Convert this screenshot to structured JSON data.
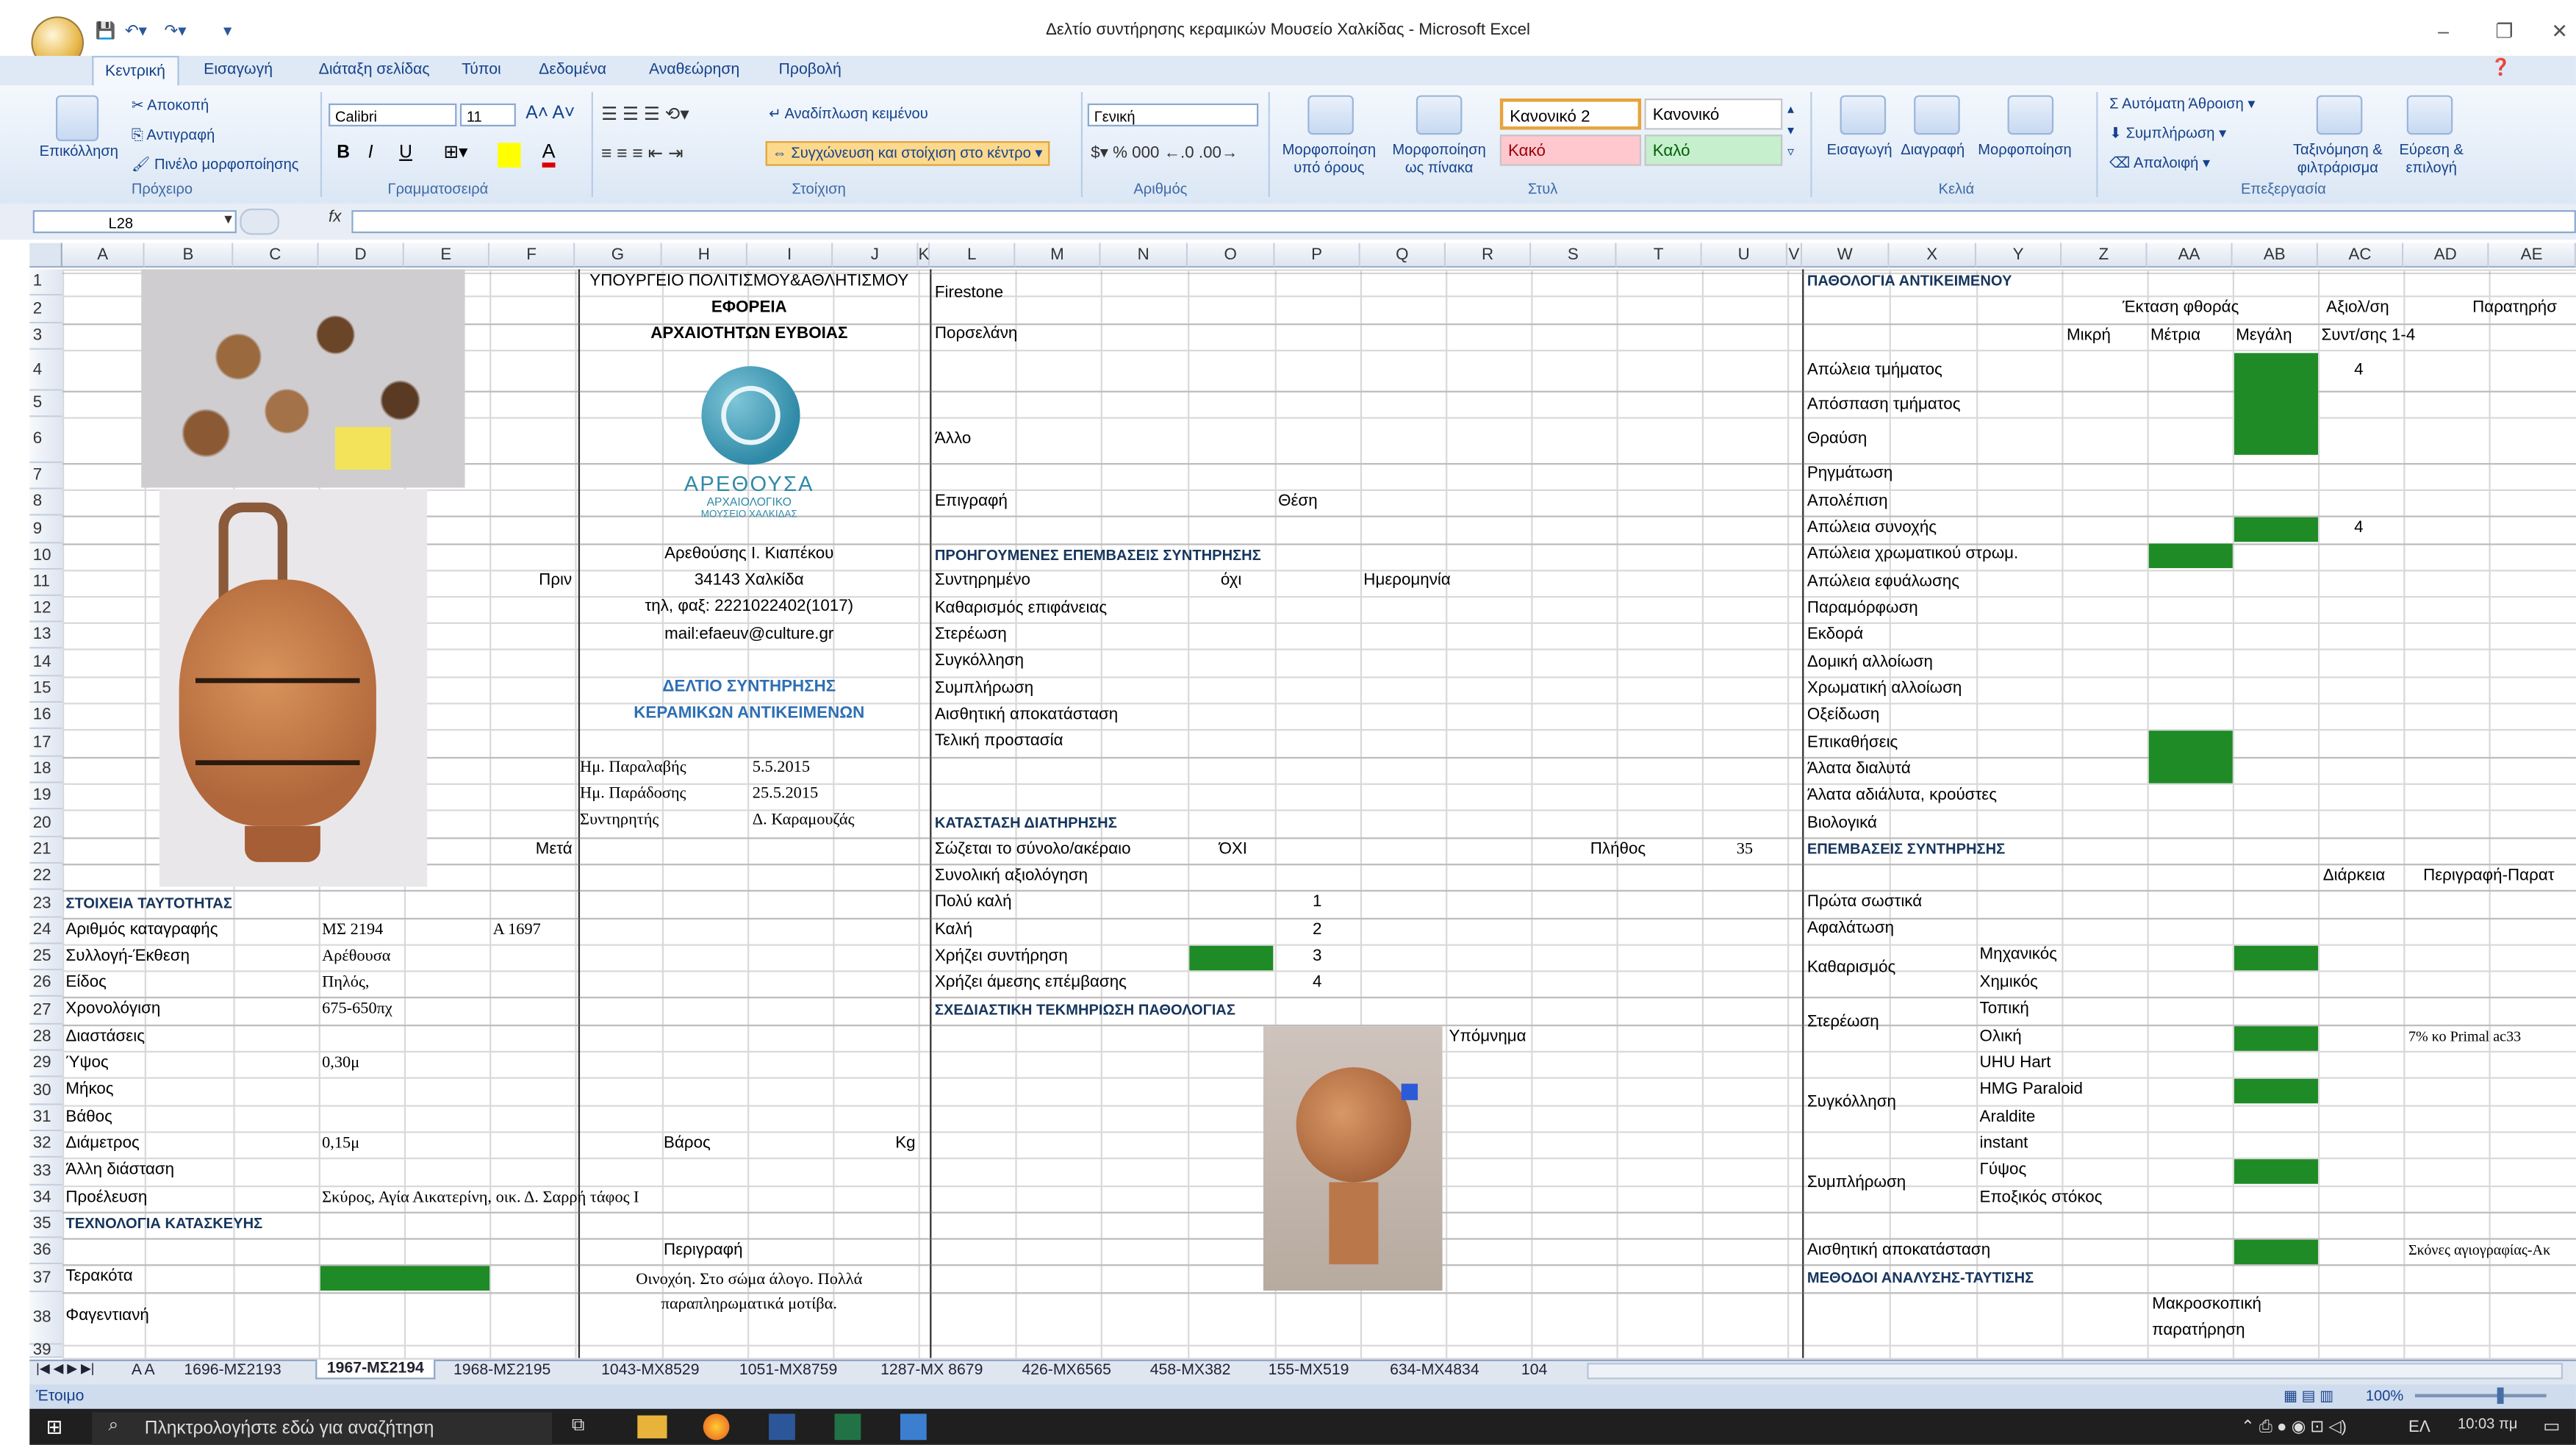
{
  "window": {
    "title": "Δελτίο συντήρησης κεραμικών Μουσείο Χαλκίδας - Microsoft Excel",
    "controls": [
      "–",
      "❐",
      "✕"
    ]
  },
  "ribbon": {
    "tabs": [
      "Κεντρική",
      "Εισαγωγή",
      "Διάταξη σελίδας",
      "Τύποι",
      "Δεδομένα",
      "Αναθεώρηση",
      "Προβολή"
    ],
    "clipboard": {
      "paste": "Επικόλληση",
      "cut": "Αποκοπή",
      "copy": "Αντιγραφή",
      "painter": "Πινέλο μορφοποίησης",
      "label": "Πρόχειρο"
    },
    "font": {
      "name": "Calibri",
      "size": "11",
      "label": "Γραμματοσειρά"
    },
    "alignment": {
      "wrap": "Αναδίπλωση κειμένου",
      "merge": "Συγχώνευση και στοίχιση στο κέντρο",
      "label": "Στοίχιση"
    },
    "number": {
      "format": "Γενική",
      "label": "Αριθμός"
    },
    "styles": {
      "conditional": "Μορφοποίηση υπό όρους",
      "table": "Μορφοποίηση ως πίνακα",
      "s1": "Κανονικό 2",
      "s2": "Κανονικό",
      "bad": "Κακό",
      "good": "Καλό",
      "label": "Στυλ"
    },
    "cells": {
      "insert": "Εισαγωγή",
      "delete": "Διαγραφή",
      "format": "Μορφοποίηση",
      "label": "Κελιά"
    },
    "editing": {
      "autosum": "Αυτόματη Άθροιση",
      "fill": "Συμπλήρωση",
      "clear": "Απαλοιφή",
      "sort": "Ταξινόμηση & φιλτράρισμα",
      "find": "Εύρεση & επιλογή",
      "label": "Επεξεργασία"
    }
  },
  "formula_bar": {
    "name_box": "L28",
    "fx": "fx",
    "value": ""
  },
  "columns": [
    "A",
    "B",
    "C",
    "D",
    "E",
    "F",
    "G",
    "H",
    "I",
    "J",
    "K",
    "L",
    "M",
    "N",
    "O",
    "P",
    "Q",
    "R",
    "S",
    "T",
    "U",
    "V",
    "W",
    "X",
    "Y",
    "Z",
    "AA",
    "AB",
    "AC",
    "AD",
    "AE"
  ],
  "rows": [
    "1",
    "2",
    "3",
    "4",
    "5",
    "6",
    "7",
    "8",
    "9",
    "10",
    "11",
    "12",
    "13",
    "14",
    "15",
    "16",
    "17",
    "18",
    "19",
    "20",
    "21",
    "22",
    "23",
    "24",
    "25",
    "26",
    "27",
    "28",
    "29",
    "30",
    "31",
    "32",
    "33",
    "34",
    "35",
    "36",
    "37",
    "38",
    "39"
  ],
  "header_block": {
    "ministry": "ΥΠΟΥΡΓΕΙΟ ΠΟΛΙΤΙΣΜΟΥ&ΑΘΛΗΤΙΣΜΟΥ",
    "ephorate": "ΕΦΟΡΕΙΑ",
    "antiquities": "ΑΡΧΑΙΟΤΗΤΩΝ ΕΥΒΟΙΑΣ",
    "logo_name": "ΑΡΕΘΟΥΣΑ",
    "logo_sub1": "ΑΡΧΑΙΟΛΟΓΙΚΟ",
    "logo_sub2": "ΜΟΥΣΕΙΟ ΧΑΛΚΙΔΑΣ",
    "address": "Αρεθούσης Ι. Κιαπέκου",
    "city": "34143  Χαλκίδα",
    "phone": "τηλ, φαξ: 2221022402(1017)",
    "mail": "mail:efaeuv@culture.gr",
    "sheet_title1": "ΔΕΛΤΙΟ ΣΥΝΤΗΡΗΣΗΣ",
    "sheet_title2": "ΚΕΡΑΜΙΚΩΝ ΑΝΤΙΚΕΙΜΕΝΩΝ",
    "before": "Πριν",
    "after": "Μετά",
    "received_label": "Ημ. Παραλαβής",
    "received": "5.5.2015",
    "delivered_label": "Ημ. Παράδοσης",
    "delivered": "25.5.2015",
    "conservator_label": "Συντηρητής",
    "conservator": "Δ. Καραμουζάς"
  },
  "identity": {
    "heading": "ΣΤΟΙΧΕΙΑ ΤΑΥΤΟΤΗΤΑΣ",
    "rows": [
      {
        "label": "Αριθμός καταγραφής",
        "value": "ΜΣ 2194",
        "extra": "Α 1697"
      },
      {
        "label": "Συλλογή-Έκθεση",
        "value": "Αρέθουσα",
        "extra": ""
      },
      {
        "label": "Είδος",
        "value": "Πηλός,",
        "extra": ""
      },
      {
        "label": "Χρονολόγιση",
        "value": "675-650πχ",
        "extra": ""
      },
      {
        "label": "Διαστάσεις",
        "value": "",
        "extra": ""
      },
      {
        "label": "Ύψος",
        "value": "0,30μ",
        "extra": ""
      },
      {
        "label": "Μήκος",
        "value": "",
        "extra": ""
      },
      {
        "label": "Βάθος",
        "value": "",
        "extra": ""
      },
      {
        "label": "Διάμετρος",
        "value": "0,15μ",
        "extra": ""
      },
      {
        "label": "Άλλη διάσταση",
        "value": "",
        "extra": ""
      },
      {
        "label": "Προέλευση",
        "value": "Σκύρος, Αγία Αικατερίνη, οικ. Δ. Σαρρή τάφος Ι",
        "extra": ""
      }
    ],
    "weight_label": "Βάρος",
    "weight_unit": "Kg",
    "technology_heading": "ΤΕΧΝΟΛΟΓΙΑ ΚΑΤΑΣΚΕΥΗΣ",
    "description_label": "Περιγραφή",
    "terracotta": "Τερακότα",
    "faience": "Φαγεντιανή",
    "description": "Οινοχόη. Στο σώμα άλογο. Πολλά παραπληρωματικά μοτίβα."
  },
  "materials": {
    "firestone": "Firestone",
    "porcelain": "Πορσελάνη",
    "other": "Άλλο",
    "inscription": "Επιγραφή",
    "position": "Θέση"
  },
  "previous": {
    "heading": "ΠΡΟΗΓΟΥΜΕΝΕΣ ΕΠΕΜΒΑΣΕΙΣ ΣΥΝΤΗΡΗΣΗΣ",
    "conserved": "Συντηρημένο",
    "conserved_val": "όχι",
    "date_label": "Ημερομηνία",
    "items": [
      "Καθαρισμός επιφάνειας",
      "Στερέωση",
      "Συγκόλληση",
      "Συμπλήρωση",
      "Αισθητική αποκατάσταση",
      "Τελική προστασία"
    ]
  },
  "state": {
    "heading": "ΚΑΤΑΣΤΑΣΗ ΔΙΑΤΗΡΗΣΗΣ",
    "whole": "Σώζεται το σύνολο/ακέραιο",
    "whole_val": "ΌΧΙ",
    "count_label": "Πλήθος",
    "count": "35",
    "overall": "Συνολική αξιολόγηση",
    "levels": [
      {
        "label": "Πολύ καλή",
        "num": "1"
      },
      {
        "label": "Καλή",
        "num": "2"
      },
      {
        "label": "Χρήζει συντήρηση",
        "num": "3"
      },
      {
        "label": "Χρήζει άμεσης επέμβασης",
        "num": "4"
      }
    ],
    "drawing_heading": "ΣΧΕΔΙΑΣΤΙΚΗ ΤΕΚΜΗΡΙΩΣΗ ΠΑΘΟΛΟΓΙΑΣ",
    "legend": "Υπόμνημα"
  },
  "pathology": {
    "heading": "ΠΑΘΟΛΟΓΙΑ ΑΝΤΙΚΕΙΜΕΝΟΥ",
    "extent": "Έκταση φθοράς",
    "evaluation": "Αξιολ/ση",
    "remarks": "Παρατηρήσ",
    "small": "Μικρή",
    "medium": "Μέτρια",
    "large": "Μεγάλη",
    "scale": "Συντ/σης 1-4",
    "items": [
      "Απώλεια τμήματος",
      "Απόσπαση τμήματος",
      "Θραύση",
      "Ρηγμάτωση",
      "Απολέπιση",
      "Απώλεια συνοχής",
      "Απώλεια χρωματικού στρωμ.",
      "Απώλεια εφυάλωσης",
      "Παραμόρφωση",
      "Εκδορά",
      "Δομική αλλοίωση",
      "Χρωματική αλλοίωση",
      "Οξείδωση",
      "Επικαθήσεις",
      "Άλατα διαλυτά",
      "Άλατα αδιάλυτα, κρούστες",
      "Βιολογικά"
    ],
    "score1": "4",
    "score2": "4"
  },
  "interventions": {
    "heading": "ΕΠΕΜΒΑΣΕΙΣ ΣΥΝΤΗΡΗΣΗΣ",
    "duration": "Διάρκεια",
    "description": "Περιγραφή-Παρατ",
    "first_aid": "Πρώτα σωστικά",
    "desalination": "Αφαλάτωση",
    "cleaning": "Καθαρισμός",
    "mechanical": "Μηχανικός",
    "chemical": "Χημικός",
    "consolidation": "Στερέωση",
    "local": "Τοπική",
    "total": "Ολική",
    "primal": "7% κο Primal ac33",
    "bonding": "Συγκόλληση",
    "adhesives": [
      "UHU Hart",
      "HMG Paraloid",
      "Araldite",
      "instant"
    ],
    "filling": "Συμπλήρωση",
    "plaster": "Γύψος",
    "epoxy": "Εποξικός στόκος",
    "aesthetic": "Αισθητική αποκατάσταση",
    "pigments": "Σκόνες αγιογραφίας-Ακ",
    "methods_heading": "ΜΕΘΟΔΟΙ ΑΝΑΛΥΣΗΣ-ΤΑΥΤΙΣΗΣ",
    "macro1": "Μακροσκοπική",
    "macro2": "παρατήρηση"
  },
  "sheet_tabs": [
    "A A",
    "1696-ΜΣ2193",
    "1967-ΜΣ2194",
    "1968-ΜΣ2195",
    "1043-ΜΧ8529",
    "1051-ΜΧ8759",
    "1287-ΜΧ 8679",
    "426-ΜΧ6565",
    "458-ΜΧ382",
    "155-ΜΧ519",
    "634-ΜΧ4834",
    "104"
  ],
  "active_sheet": "1967-ΜΣ2194",
  "status": {
    "mode": "Έτοιμο",
    "zoom": "100%"
  },
  "taskbar": {
    "search": "Πληκτρολογήστε εδώ για αναζήτηση",
    "lang": "ΕΛ",
    "time": "10:03 πμ"
  },
  "colors": {
    "fill_green": "#1e8b27",
    "section_blue": "#17365d",
    "ribbon": "#dbe7f5"
  }
}
